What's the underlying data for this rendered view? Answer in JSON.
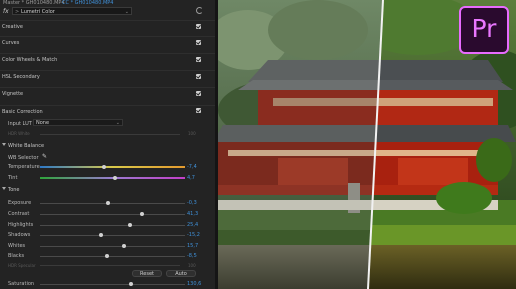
{
  "header": {
    "master_label": "Master * GH010480.MP4",
    "clip_label": "CC * GH010480.MP4"
  },
  "effect": {
    "fx_icon": "fx-icon",
    "name": "Lumetri Color",
    "prefix": ">"
  },
  "sections": {
    "creative": "Creative",
    "curves": "Curves",
    "color_wheels": "Color Wheels & Match",
    "hsl": "HSL Secondary",
    "vignette": "Vignette",
    "basic": "Basic Correction"
  },
  "input_lut": {
    "label": "Input LUT",
    "value": "None"
  },
  "hdr_white": {
    "label": "HDR White",
    "value": "100"
  },
  "white_balance": {
    "group": "White Balance",
    "selector_label": "WB Selector",
    "temperature": {
      "label": "Temperature",
      "value": "-7,4",
      "level": 0.44
    },
    "tint": {
      "label": "Tint",
      "value": "4,7",
      "level": 0.52
    }
  },
  "tone": {
    "group": "Tone",
    "rows": [
      {
        "label": "Exposure",
        "value": "-0,3",
        "level": 0.47
      },
      {
        "label": "Contrast",
        "value": "41,3",
        "level": 0.7
      },
      {
        "label": "Highlights",
        "value": "25,4",
        "level": 0.62
      },
      {
        "label": "Shadows",
        "value": "-15,2",
        "level": 0.42
      },
      {
        "label": "Whites",
        "value": "15,7",
        "level": 0.58
      },
      {
        "label": "Blacks",
        "value": "-8,5",
        "level": 0.46
      }
    ]
  },
  "hdr_specular": {
    "label": "HDR Specular",
    "value": "100"
  },
  "buttons": {
    "reset": "Reset",
    "auto": "Auto"
  },
  "saturation": {
    "label": "Saturation",
    "value": "130,6",
    "level": 0.63
  },
  "logo": {
    "text": "Pr",
    "color": "#ea77ff"
  }
}
